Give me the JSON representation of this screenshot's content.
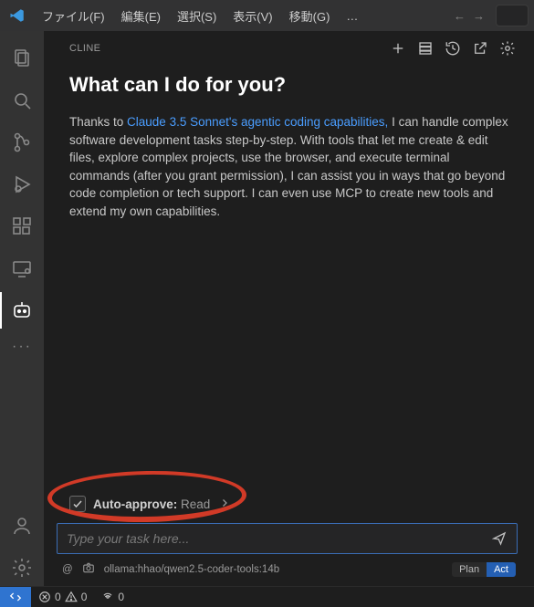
{
  "menu": {
    "file": "ファイル(F)",
    "edit": "編集(E)",
    "select": "選択(S)",
    "view": "表示(V)",
    "go": "移動(G)",
    "more": "…"
  },
  "panel": {
    "title": "CLINE",
    "heading": "What can I do for you?",
    "intro_pre": "Thanks to ",
    "intro_link": "Claude 3.5 Sonnet's agentic coding capabilities,",
    "intro_post": " I can handle complex software development tasks step-by-step. With tools that let me create & edit files, explore complex projects, use the browser, and execute terminal commands (after you grant permission), I can assist you in ways that go beyond code completion or tech support. I can even use MCP to create new tools and extend my own capabilities."
  },
  "autoApprove": {
    "label": "Auto-approve:",
    "value": "Read"
  },
  "input": {
    "placeholder": "Type your task here..."
  },
  "provider": {
    "text": "ollama:hhao/qwen2.5-coder-tools:14b"
  },
  "mode": {
    "plan": "Plan",
    "act": "Act"
  },
  "status": {
    "errors": "0",
    "warnings": "0",
    "ports": "0"
  }
}
